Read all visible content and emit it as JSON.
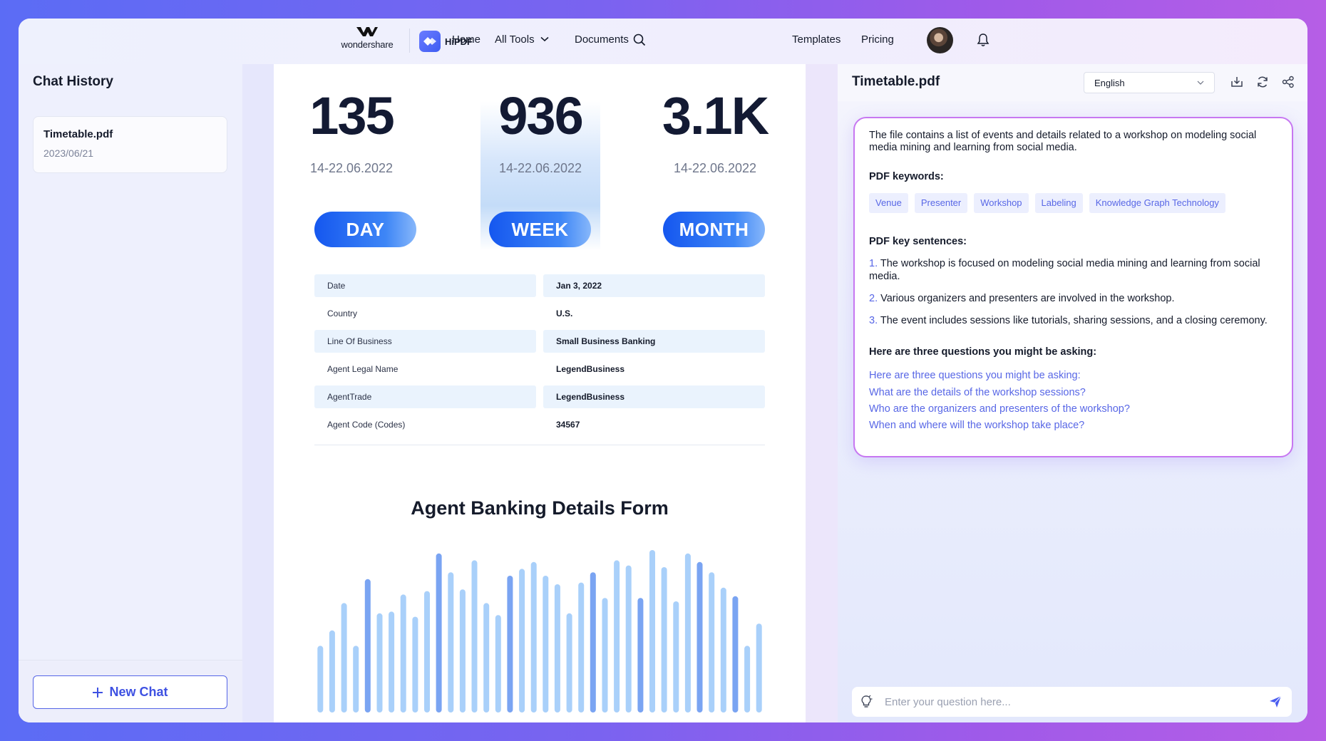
{
  "header": {
    "brand": "wondershare",
    "product": "HiPDF",
    "nav": {
      "home": "Home",
      "all_tools": "All Tools",
      "documents": "Documents",
      "templates": "Templates",
      "pricing": "Pricing"
    }
  },
  "sidebar": {
    "title": "Chat History",
    "history": [
      {
        "name": "Timetable.pdf",
        "date": "2023/06/21"
      }
    ],
    "new_chat": "New Chat"
  },
  "document": {
    "stats": [
      {
        "value": "135",
        "date": "14-22.06.2022",
        "label": "DAY"
      },
      {
        "value": "936",
        "date": "14-22.06.2022",
        "label": "WEEK"
      },
      {
        "value": "3.1K",
        "date": "14-22.06.2022",
        "label": "MONTH"
      }
    ],
    "form": [
      {
        "key": "Date",
        "value": "Jan 3, 2022"
      },
      {
        "key": "Country",
        "value": "U.S."
      },
      {
        "key": "Line Of Business",
        "value": "Small Business Banking"
      },
      {
        "key": "Agent Legal Name",
        "value": "LegendBusiness"
      },
      {
        "key": "AgentTrade",
        "value": "LegendBusiness"
      },
      {
        "key": "Agent Code (Codes)",
        "value": "34567"
      }
    ],
    "form_title": "Agent Banking Details Form",
    "bars": {
      "values": [
        0.39,
        0.48,
        0.64,
        0.39,
        0.78,
        0.58,
        0.59,
        0.69,
        0.56,
        0.71,
        0.93,
        0.82,
        0.72,
        0.89,
        0.64,
        0.57,
        0.8,
        0.84,
        0.88,
        0.8,
        0.75,
        0.58,
        0.76,
        0.82,
        0.67,
        0.89,
        0.86,
        0.67,
        0.95,
        0.85,
        0.65,
        0.93,
        0.88,
        0.82,
        0.73,
        0.68,
        0.39,
        0.52
      ],
      "dark_indices": [
        4,
        10,
        16,
        23,
        27,
        32,
        35
      ],
      "light_color": "#a9d0fa",
      "dark_color": "#7aa4f2"
    }
  },
  "panel": {
    "file_title": "Timetable.pdf",
    "language": "English",
    "summary": "The file contains a list of events and details related to a workshop on modeling social media mining and learning from social media.",
    "keywords_title": "PDF keywords:",
    "keywords": [
      "Venue",
      "Presenter",
      "Workshop",
      "Labeling",
      "Knowledge Graph Technology"
    ],
    "sentences_title": "PDF key sentences:",
    "sentences": [
      {
        "n": "1.",
        "text": "The workshop is focused on modeling social media mining and learning from social media."
      },
      {
        "n": "2.",
        "text": "Various organizers and presenters are involved in the workshop."
      },
      {
        "n": "3.",
        "text": "The event includes sessions like tutorials, sharing sessions, and a closing ceremony."
      }
    ],
    "questions_title": "Here are three questions you might be asking:",
    "questions": [
      "Here are three questions you might be asking:",
      "What are the details of the workshop sessions?",
      "Who are the organizers and presenters of the workshop?",
      "When and where will the workshop take place?"
    ],
    "input_placeholder": "Enter your question here..."
  },
  "colors": {
    "accent": "#4a5df0",
    "pill": "#1a5cf0",
    "card_border": "#c777f1"
  }
}
